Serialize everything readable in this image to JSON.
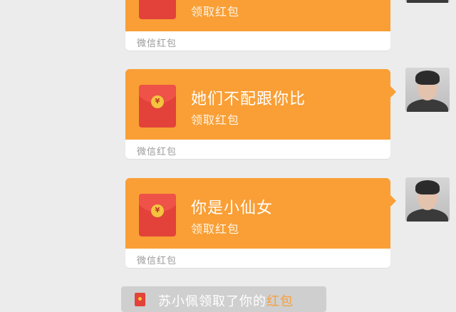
{
  "messages": [
    {
      "greeting": "",
      "action": "领取红包",
      "source": "微信红包"
    },
    {
      "greeting": "她们不配跟你比",
      "action": "领取红包",
      "source": "微信红包"
    },
    {
      "greeting": "你是小仙女",
      "action": "领取红包",
      "source": "微信红包"
    }
  ],
  "envelope": {
    "seal_symbol": "¥"
  },
  "notice": {
    "prefix": "苏小佩领取了你的",
    "link": "红包"
  },
  "colors": {
    "background": "#ececec",
    "packet_orange": "#f99f36",
    "envelope_red": "#e2423a",
    "seal_gold": "#f4c43f",
    "link_orange": "#f99f36"
  },
  "icons": {
    "packet": "red-envelope-icon",
    "avatar": "user-avatar"
  }
}
